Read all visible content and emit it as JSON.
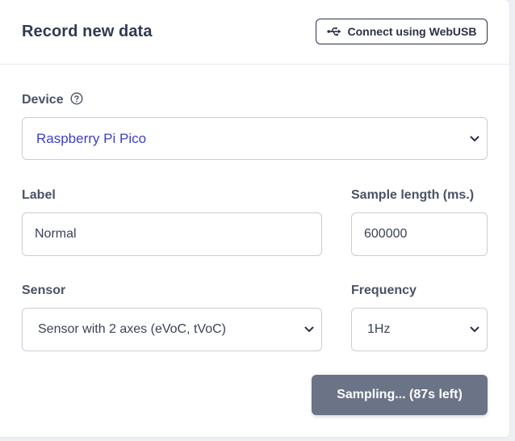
{
  "header": {
    "title": "Record new data",
    "webusb_label": "Connect using WebUSB"
  },
  "device": {
    "label": "Device",
    "value": "Raspberry Pi Pico"
  },
  "label_field": {
    "label": "Label",
    "value": "Normal"
  },
  "sample_length": {
    "label": "Sample length (ms.)",
    "value": "600000"
  },
  "sensor": {
    "label": "Sensor",
    "value": "Sensor with 2 axes (eVoC, tVoC)"
  },
  "frequency": {
    "label": "Frequency",
    "value": "1Hz"
  },
  "sampling_button": {
    "label": "Sampling... (87s left)"
  },
  "colors": {
    "title": "#323a4e",
    "device_value": "#3b3fc9",
    "sampling_button_bg": "#6b7386"
  },
  "icons": [
    "usb-icon",
    "help-circle-icon",
    "chevron-down-icon"
  ]
}
